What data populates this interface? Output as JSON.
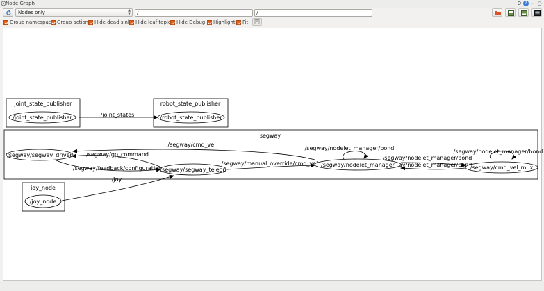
{
  "window": {
    "title": "Node Graph"
  },
  "toolbar": {
    "graph_mode": "Nodes only",
    "namespace_filter": "/",
    "topic_filter": "/",
    "icons": [
      "refresh-icon",
      "open-icon",
      "save-dot-icon",
      "save-svg-icon",
      "screenshot-icon"
    ]
  },
  "options": {
    "group_namespaces": "Group namespaces",
    "group_actions": "Group actions",
    "hide_dead_sinks": "Hide dead sinks",
    "hide_leaf_topics": "Hide leaf topics",
    "hide_debug": "Hide Debug",
    "highlight": "Highlight",
    "fit": "Fit"
  },
  "graph": {
    "clusters": {
      "joint_state_publisher": "joint_state_publisher",
      "robot_state_publisher": "robot_state_publisher",
      "segway": "segway",
      "joy_node": "joy_node"
    },
    "nodes": {
      "joint_state_publisher": "/joint_state_publisher",
      "robot_state_publisher": "/robot_state_publisher",
      "segway_driver": "/segway/segway_driver",
      "segway_teleop": "/segway/segway_teleop",
      "nodelet_manager": "/segway/nodelet_manager",
      "cmd_vel_mux": "/segway/cmd_vel_mux",
      "joy_node": "/joy_node"
    },
    "edges": {
      "joint_states": "/joint_states",
      "cmd_vel": "/segway/cmd_vel",
      "gp_command": "/segway/gp_command",
      "feedback_configuration": "/segway/feedback/configuration",
      "joy": "/joy",
      "manual_override": "/segway/manual_override/cmd_vel",
      "bond_self_manager": "/segway/nodelet_manager/bond",
      "bond_to_mux": "/segway/nodelet_manager/bond",
      "bond_to_manager": "/segway/nodelet_manager/bond",
      "bond_self_mux": "/segway/nodelet_manager/bond"
    }
  },
  "colors": {
    "accent": "#e5611a",
    "canvas": "#ffffff"
  }
}
